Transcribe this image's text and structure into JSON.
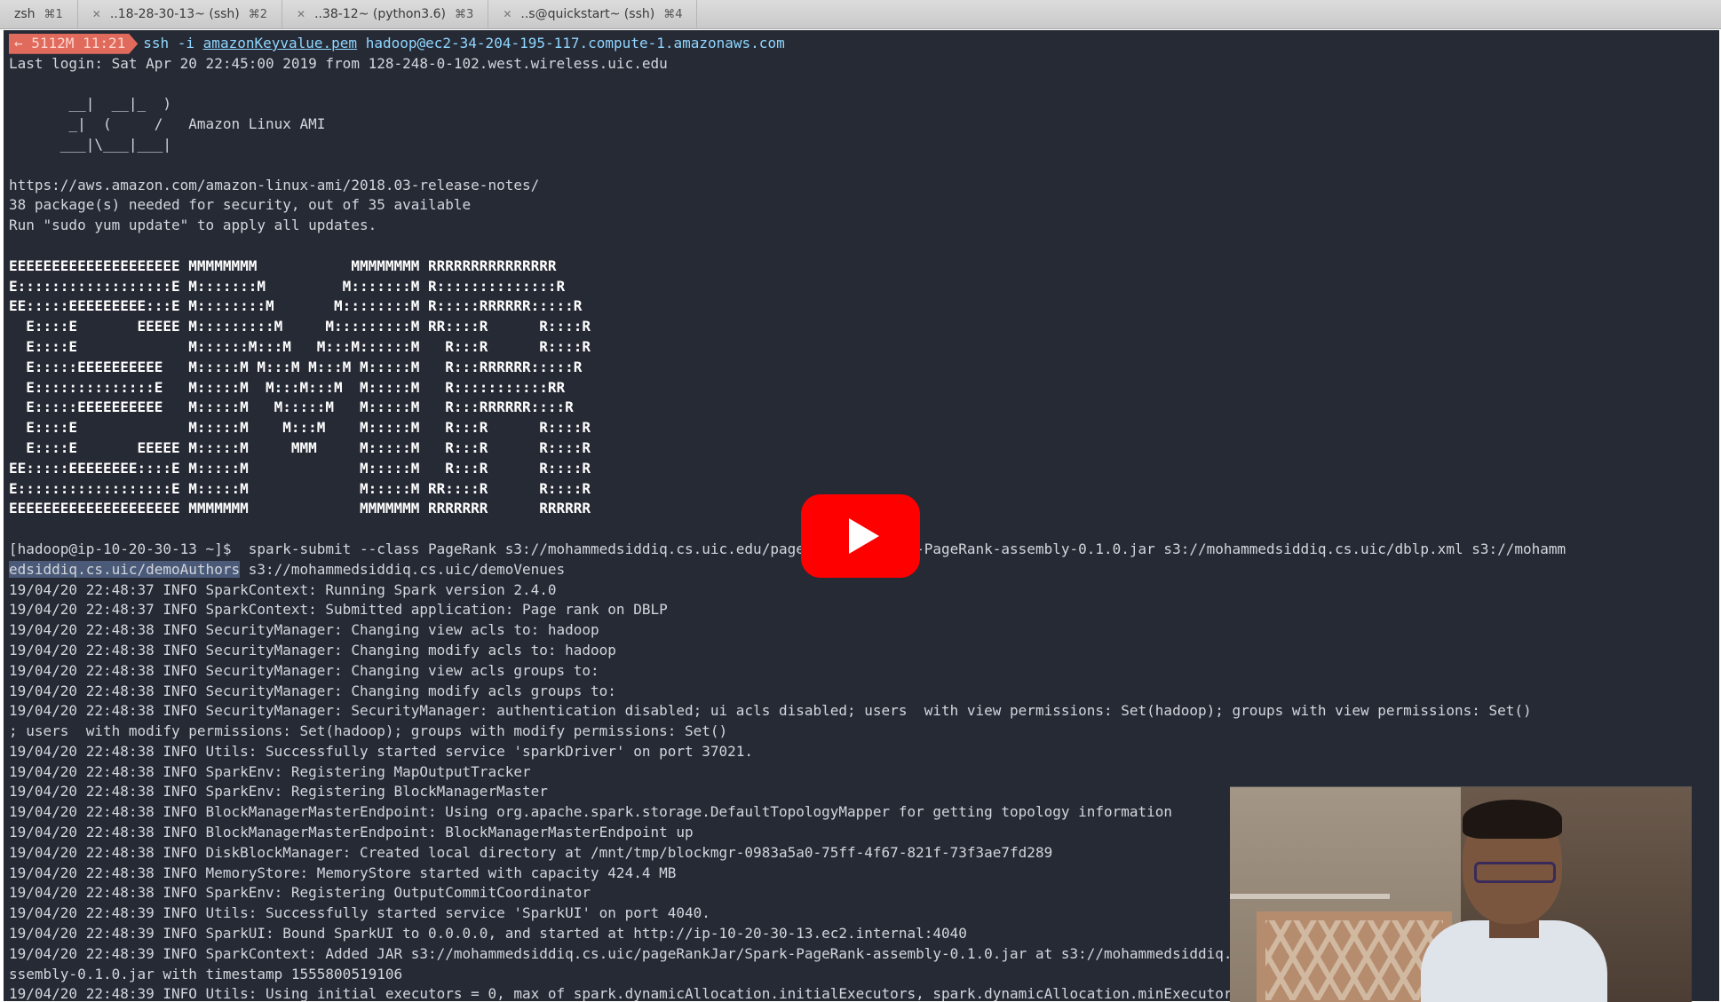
{
  "tabs": [
    {
      "label": "zsh",
      "num": "⌘1"
    },
    {
      "label": "..18-28-30-13~ (ssh)",
      "num": "⌘2"
    },
    {
      "label": "..38-12~ (python3.6)",
      "num": "⌘3"
    },
    {
      "label": "..s@quickstart~ (ssh)",
      "num": "⌘4"
    }
  ],
  "terminal": {
    "prompt_badge": "← 5112M 11:21",
    "command": {
      "prefix": "ssh -i ",
      "key": "amazonKeyvalue.pem",
      "host": " hadoop@ec2-34-204-195-117.compute-1.amazonaws.com"
    },
    "last_login": "Last login: Sat Apr 20 22:45:00 2019 from 128-248-0-102.west.wireless.uic.edu",
    "ami_logo": [
      "       __|  __|_  )",
      "       _|  (     /   Amazon Linux AMI",
      "      ___|\\___|___|"
    ],
    "notes": [
      "https://aws.amazon.com/amazon-linux-ami/2018.03-release-notes/",
      "38 package(s) needed for security, out of 35 available",
      "Run \"sudo yum update\" to apply all updates."
    ],
    "emr_banner": [
      "EEEEEEEEEEEEEEEEEEEE MMMMMMMM           MMMMMMMM RRRRRRRRRRRRRRR",
      "E::::::::::::::::::E M:::::::M         M:::::::M R::::::::::::::R",
      "EE:::::EEEEEEEEE:::E M::::::::M       M::::::::M R:::::RRRRRR:::::R",
      "  E::::E       EEEEE M:::::::::M     M:::::::::M RR::::R      R::::R",
      "  E::::E             M::::::M:::M   M:::M::::::M   R:::R      R::::R",
      "  E:::::EEEEEEEEEE   M:::::M M:::M M:::M M:::::M   R:::RRRRRR:::::R",
      "  E::::::::::::::E   M:::::M  M:::M:::M  M:::::M   R:::::::::::RR",
      "  E:::::EEEEEEEEEE   M:::::M   M:::::M   M:::::M   R:::RRRRRR::::R",
      "  E::::E             M:::::M    M:::M    M:::::M   R:::R      R::::R",
      "  E::::E       EEEEE M:::::M     MMM     M:::::M   R:::R      R::::R",
      "EE:::::EEEEEEEE::::E M:::::M             M:::::M   R:::R      R::::R",
      "E::::::::::::::::::E M:::::M             M:::::M RR::::R      R::::R",
      "EEEEEEEEEEEEEEEEEEEE MMMMMMM             MMMMMMM RRRRRRR      RRRRRR"
    ],
    "spark_cmd_1": "[hadoop@ip-10-20-30-13 ~]$  spark-submit --class PageRank s3://mohammedsiddiq.cs.uic.edu/pageRankJar/Spark-PageRank-assembly-0.1.0.jar s3://mohammedsiddiq.cs.uic/dblp.xml s3://mohamm",
    "spark_cmd_2_sel": "edsiddiq.cs.uic/demoAuthors",
    "spark_cmd_2_rest": " s3://mohammedsiddiq.cs.uic/demoVenues",
    "logs": [
      "19/04/20 22:48:37 INFO SparkContext: Running Spark version 2.4.0",
      "19/04/20 22:48:37 INFO SparkContext: Submitted application: Page rank on DBLP",
      "19/04/20 22:48:38 INFO SecurityManager: Changing view acls to: hadoop",
      "19/04/20 22:48:38 INFO SecurityManager: Changing modify acls to: hadoop",
      "19/04/20 22:48:38 INFO SecurityManager: Changing view acls groups to:",
      "19/04/20 22:48:38 INFO SecurityManager: Changing modify acls groups to:",
      "19/04/20 22:48:38 INFO SecurityManager: SecurityManager: authentication disabled; ui acls disabled; users  with view permissions: Set(hadoop); groups with view permissions: Set()",
      "; users  with modify permissions: Set(hadoop); groups with modify permissions: Set()",
      "19/04/20 22:48:38 INFO Utils: Successfully started service 'sparkDriver' on port 37021.",
      "19/04/20 22:48:38 INFO SparkEnv: Registering MapOutputTracker",
      "19/04/20 22:48:38 INFO SparkEnv: Registering BlockManagerMaster",
      "19/04/20 22:48:38 INFO BlockManagerMasterEndpoint: Using org.apache.spark.storage.DefaultTopologyMapper for getting topology information",
      "19/04/20 22:48:38 INFO BlockManagerMasterEndpoint: BlockManagerMasterEndpoint up",
      "19/04/20 22:48:38 INFO DiskBlockManager: Created local directory at /mnt/tmp/blockmgr-0983a5a0-75ff-4f67-821f-73f3ae7fd289",
      "19/04/20 22:48:38 INFO MemoryStore: MemoryStore started with capacity 424.4 MB",
      "19/04/20 22:48:38 INFO SparkEnv: Registering OutputCommitCoordinator",
      "19/04/20 22:48:39 INFO Utils: Successfully started service 'SparkUI' on port 4040.",
      "19/04/20 22:48:39 INFO SparkUI: Bound SparkUI to 0.0.0.0, and started at http://ip-10-20-30-13.ec2.internal:4040",
      "19/04/20 22:48:39 INFO SparkContext: Added JAR s3://mohammedsiddiq.cs.uic/pageRankJar/Spark-PageRank-assembly-0.1.0.jar at s3://mohammedsiddiq.cs.uic/pageRankJar/Spark-PageRank-a",
      "ssembly-0.1.0.jar with timestamp 1555800519106",
      "19/04/20 22:48:39 INFO Utils: Using initial executors = 0, max of spark.dynamicAllocation.initialExecutors, spark.dynamicAllocation.minExecutors and spark.executor.instances"
    ]
  },
  "colors": {
    "terminal_bg": "#262a35",
    "text": "#d3d6dc",
    "prompt_badge": "#e06a5c",
    "command": "#8fd6ff",
    "play_button": "#ff0000"
  },
  "icons": {
    "play": "youtube-play-icon",
    "tab_close": "close-icon"
  }
}
